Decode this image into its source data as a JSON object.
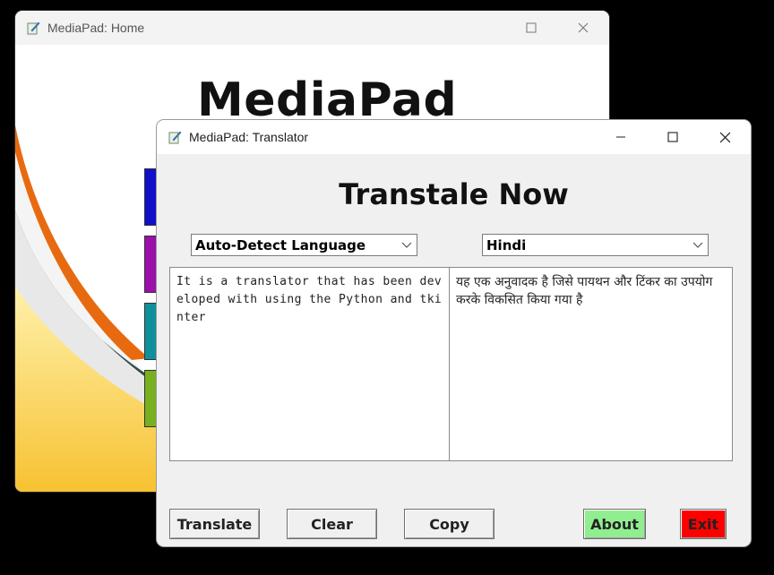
{
  "home_window": {
    "title": "MediaPad: Home",
    "heading": "MediaPad"
  },
  "translator_window": {
    "title": "MediaPad: Translator",
    "heading": "Transtale Now",
    "source_language": "Auto-Detect Language",
    "target_language": "Hindi",
    "source_text": "It is a translator that has been developed with using the Python and tkinter",
    "target_text": "यह एक अनुवादक है जिसे पायथन और टिंकर का उपयोग करके विकसित किया गया है",
    "buttons": {
      "translate": "Translate",
      "clear": "Clear",
      "copy": "Copy",
      "about": "About",
      "exit": "Exit"
    }
  },
  "icons": {
    "app": "notepad-pencil-icon",
    "minimize": "minimize-icon",
    "maximize": "maximize-icon",
    "close": "close-icon",
    "dropdown": "chevron-down-icon"
  },
  "colors": {
    "about_button": "#90ee90",
    "exit_button": "#ff0000",
    "home_button_1": "#1010c8",
    "home_button_2": "#9a10a8",
    "home_button_3": "#10909a",
    "home_button_4": "#78b020"
  }
}
